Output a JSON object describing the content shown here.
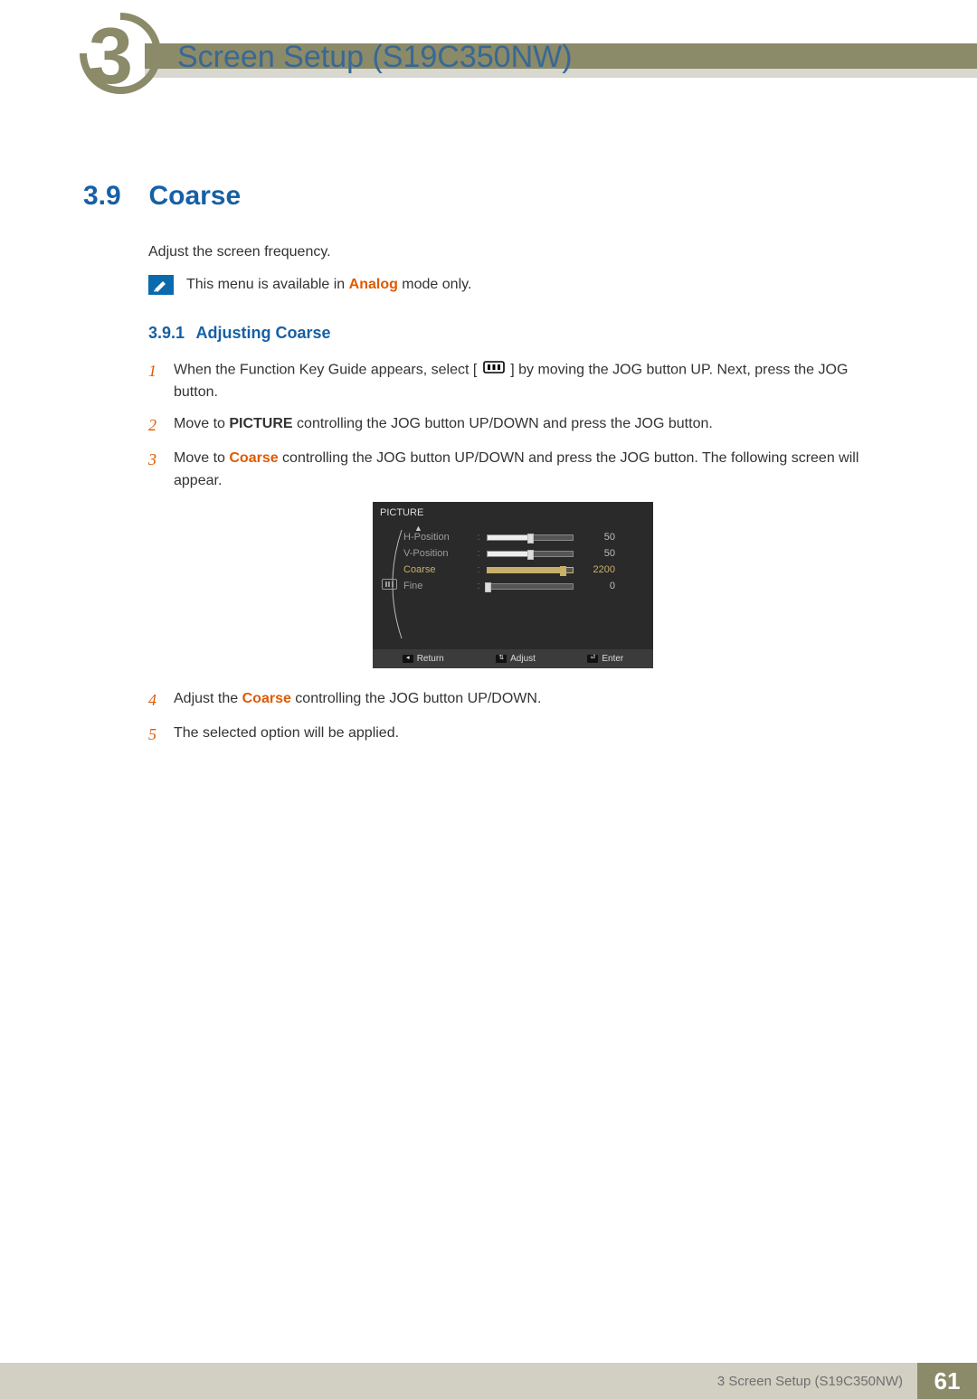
{
  "header": {
    "chapter_number": "3",
    "title": "Screen Setup (S19C350NW)"
  },
  "section": {
    "number": "3.9",
    "title": "Coarse",
    "intro": "Adjust the screen frequency."
  },
  "note": {
    "prefix": "This menu is available in ",
    "emphasis": "Analog",
    "suffix": " mode only."
  },
  "subsection": {
    "number": "3.9.1",
    "title": "Adjusting Coarse"
  },
  "steps": [
    {
      "n": "1",
      "pre": "When the Function Key Guide appears, select [",
      "post": "] by moving the JOG button UP. Next, press the JOG button."
    },
    {
      "n": "2",
      "pre": "Move to ",
      "kw": "PICTURE",
      "post": " controlling the JOG button UP/DOWN and press the JOG button."
    },
    {
      "n": "3",
      "pre": "Move to ",
      "kw": "Coarse",
      "post": " controlling the JOG button UP/DOWN and press the JOG button. The following screen will appear."
    },
    {
      "n": "4",
      "pre": "Adjust the ",
      "kw": "Coarse",
      "post": " controlling the JOG button UP/DOWN."
    },
    {
      "n": "5",
      "text": "The selected option will be applied."
    }
  ],
  "osd": {
    "title": "PICTURE",
    "rows": [
      {
        "label": "H-Position",
        "value": "50",
        "fillPct": 50,
        "active": false
      },
      {
        "label": "V-Position",
        "value": "50",
        "fillPct": 50,
        "active": false
      },
      {
        "label": "Coarse",
        "value": "2200",
        "fillPct": 88,
        "active": true
      },
      {
        "label": "Fine",
        "value": "0",
        "fillPct": 0,
        "active": false
      }
    ],
    "footer": {
      "return": "Return",
      "adjust": "Adjust",
      "enter": "Enter"
    }
  },
  "footer": {
    "breadcrumb": "3 Screen Setup (S19C350NW)",
    "page": "61"
  }
}
